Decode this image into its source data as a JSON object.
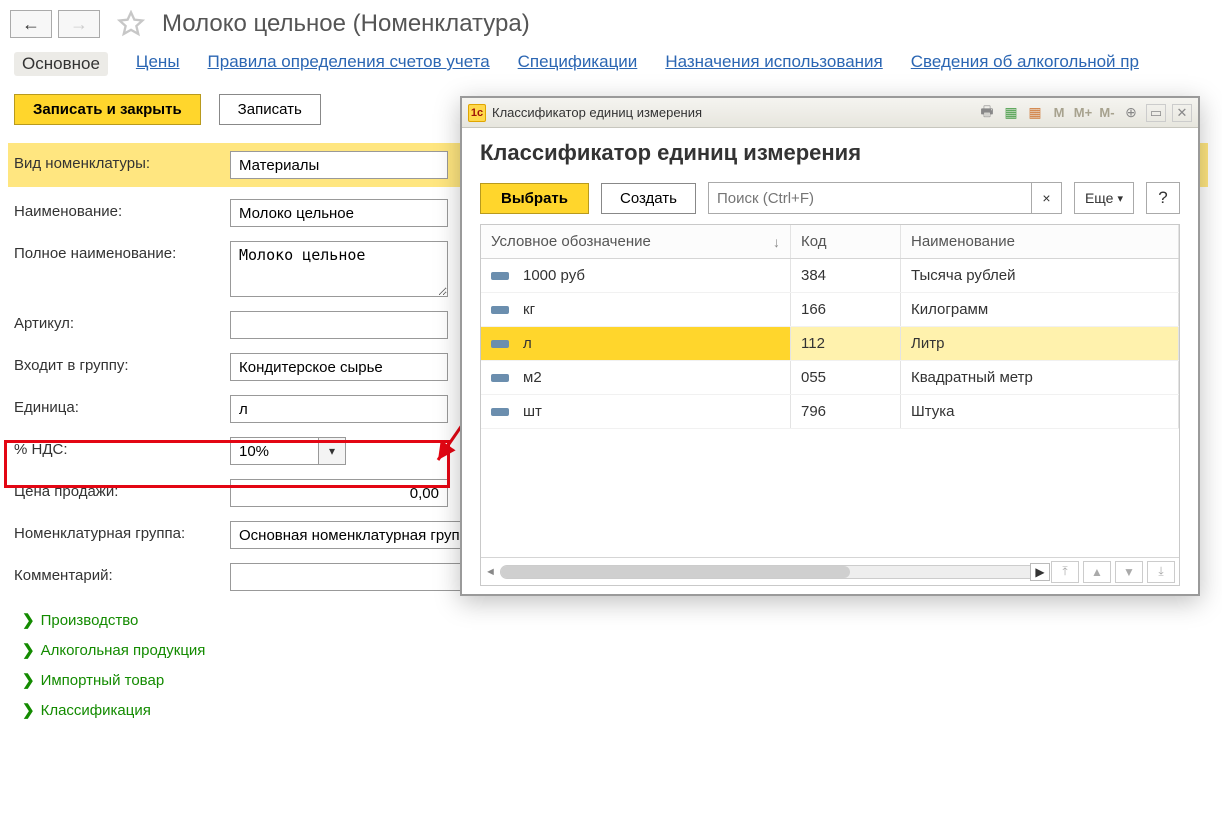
{
  "header": {
    "title": "Молоко цельное (Номенклатура)"
  },
  "tabs": {
    "main": "Основное",
    "prices": "Цены",
    "accounts": "Правила определения счетов учета",
    "specs": "Спецификации",
    "usage": "Назначения использования",
    "alcohol": "Сведения об алкогольной пр"
  },
  "toolbar": {
    "save_close": "Записать и закрыть",
    "save": "Записать"
  },
  "form": {
    "type_label": "Вид номенклатуры:",
    "type_value": "Материалы",
    "name_label": "Наименование:",
    "name_value": "Молоко цельное",
    "fullname_label": "Полное наименование:",
    "fullname_value": "Молоко цельное",
    "article_label": "Артикул:",
    "article_value": "",
    "group_label": "Входит в группу:",
    "group_value": "Кондитерское сырье",
    "unit_label": "Единица:",
    "unit_value": "л",
    "vat_label": "% НДС:",
    "vat_value": "10%",
    "price_label": "Цена продажи:",
    "price_value": "0,00",
    "nomgroup_label": "Номенклатурная группа:",
    "nomgroup_value": "Основная номенклатурная группа",
    "comment_label": "Комментарий:",
    "comment_value": ""
  },
  "expanders": {
    "production": "Производство",
    "alcohol": "Алкогольная продукция",
    "import": "Импортный товар",
    "classification": "Классификация"
  },
  "popup": {
    "window_title": "Классификатор единиц измерения",
    "heading": "Классификатор единиц измерения",
    "select_btn": "Выбрать",
    "create_btn": "Создать",
    "search_placeholder": "Поиск (Ctrl+F)",
    "more_btn": "Еще",
    "help_btn": "?",
    "columns": {
      "symbol": "Условное обозначение",
      "code": "Код",
      "name": "Наименование"
    },
    "rows": [
      {
        "symbol": "1000 руб",
        "code": "384",
        "name": "Тысяча рублей"
      },
      {
        "symbol": "кг",
        "code": "166",
        "name": "Килограмм"
      },
      {
        "symbol": "л",
        "code": "112",
        "name": "Литр"
      },
      {
        "symbol": "м2",
        "code": "055",
        "name": "Квадратный метр"
      },
      {
        "symbol": "шт",
        "code": "796",
        "name": "Штука"
      }
    ],
    "titlebar_icons": {
      "m": "M",
      "mplus": "M+",
      "mminus": "M-"
    }
  }
}
